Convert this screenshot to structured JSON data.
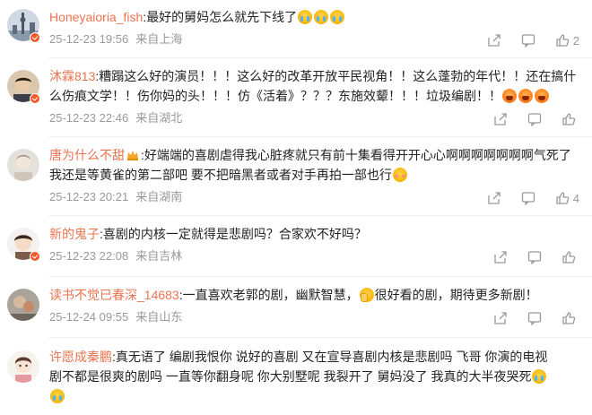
{
  "comments": [
    {
      "user": "Honeyaioria_fish",
      "segments": [
        "最好的舅妈怎么就先下线了"
      ],
      "emojis": [
        "cry",
        "cry",
        "cry"
      ],
      "date": "25-12-23 19:56",
      "location": "来自上海",
      "likes": "2"
    },
    {
      "user": "沐霖813",
      "text_line1": "糟蹋这么好的演员！！！这么好的改革开放平民视角！！这么蓬勃的年代！！还在搞什",
      "text_line2": "么伤痕文学！！伤你妈的头！！！仿《活着》？？？东施效颦！！！垃圾编剧！！",
      "emojis": [
        "angry",
        "angry",
        "angry"
      ],
      "date": "25-12-23 22:46",
      "location": "来自湖北",
      "likes": ""
    },
    {
      "user": "唐为什么不甜",
      "text_line1": "好端端的喜剧虐得我心脏疼就只有前十集看得开开心心啊啊啊啊啊啊啊气死了",
      "text_line2": "我还是等黄雀的第二部吧 要不把暗黑者或者对手再拍一部也行",
      "emojis": [
        "shy"
      ],
      "date": "25-12-23 20:21",
      "location": "来自湖南",
      "likes": "4"
    },
    {
      "user": "新的鬼子",
      "text_line1": "喜剧的内核一定就得是悲剧吗？合家欢不好吗？",
      "date": "25-12-23 22:08",
      "location": "来自吉林",
      "likes": ""
    },
    {
      "user": "读书不觉已春深_14683",
      "text_before": "一直喜欢老郭的剧，幽默智慧，",
      "text_after": "很好看的剧，期待更多新剧！",
      "emojis": [
        "cover"
      ],
      "date": "25-12-24 09:55",
      "location": "来自山东",
      "likes": ""
    },
    {
      "user": "许愿成秦鹏",
      "text_line1": "真无语了   编剧我恨你  说好的喜剧   又在宣导喜剧内核是悲剧吗  飞哥  你演的电视",
      "text_line2": "剧不都是很爽的剧吗  一直等你翻身呢  你大别墅呢  我裂开了  舅妈没了  我真的大半夜哭死",
      "emojis": [
        "cry",
        "cry"
      ]
    }
  ]
}
